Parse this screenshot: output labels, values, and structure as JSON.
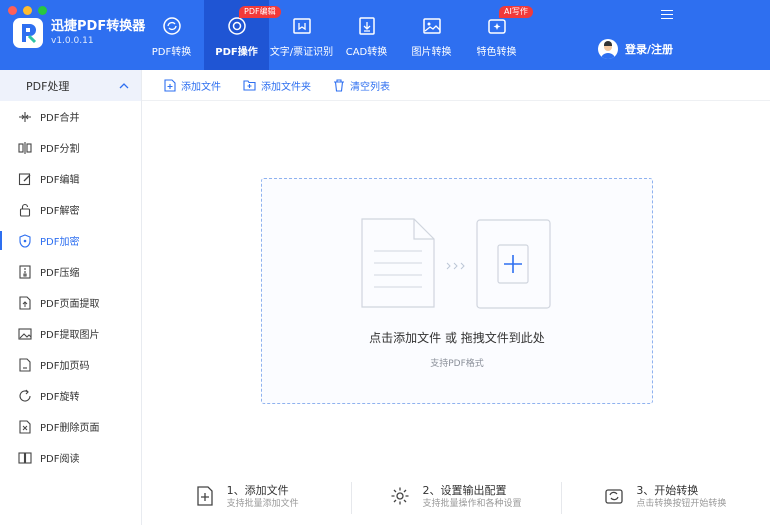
{
  "app": {
    "name": "迅捷PDF转换器",
    "version": "v1.0.0.11"
  },
  "nav": {
    "tabs": [
      {
        "label": "PDF转换",
        "icon": "refresh-chat-icon"
      },
      {
        "label": "PDF操作",
        "icon": "gear-target-icon",
        "badge": "PDF编辑",
        "active": true
      },
      {
        "label": "文字/票证识别",
        "icon": "scan-frame-icon"
      },
      {
        "label": "CAD转换",
        "icon": "cad-download-icon"
      },
      {
        "label": "图片转换",
        "icon": "image-icon"
      },
      {
        "label": "特色转换",
        "icon": "sparkle-refresh-icon",
        "badge": "AI写作"
      }
    ]
  },
  "login": {
    "label": "登录/注册"
  },
  "sidebar": {
    "header": "PDF处理",
    "items": [
      {
        "label": "PDF合并",
        "icon": "merge-icon"
      },
      {
        "label": "PDF分割",
        "icon": "split-icon"
      },
      {
        "label": "PDF编辑",
        "icon": "edit-icon"
      },
      {
        "label": "PDF解密",
        "icon": "unlock-icon"
      },
      {
        "label": "PDF加密",
        "icon": "shield-icon",
        "active": true
      },
      {
        "label": "PDF压缩",
        "icon": "compress-icon"
      },
      {
        "label": "PDF页面提取",
        "icon": "page-extract-icon"
      },
      {
        "label": "PDF提取图片",
        "icon": "image-extract-icon"
      },
      {
        "label": "PDF加页码",
        "icon": "page-number-icon"
      },
      {
        "label": "PDF旋转",
        "icon": "rotate-icon"
      },
      {
        "label": "PDF删除页面",
        "icon": "delete-page-icon"
      },
      {
        "label": "PDF阅读",
        "icon": "book-icon"
      }
    ]
  },
  "toolbar": {
    "add_file": "添加文件",
    "add_folder": "添加文件夹",
    "clear_list": "清空列表"
  },
  "dropzone": {
    "title": "点击添加文件 或 拖拽文件到此处",
    "subtitle": "支持PDF格式"
  },
  "steps": [
    {
      "title": "1、添加文件",
      "desc": "支持批量添加文件",
      "icon": "add-file-icon"
    },
    {
      "title": "2、设置输出配置",
      "desc": "支持批量操作和各种设置",
      "icon": "settings-gear-icon"
    },
    {
      "title": "3、开始转换",
      "desc": "点击转换按钮开始转换",
      "icon": "convert-icon"
    }
  ],
  "colors": {
    "primary": "#2e6ff0",
    "active_tab": "#1f55d4",
    "badge": "#f23a3a"
  }
}
